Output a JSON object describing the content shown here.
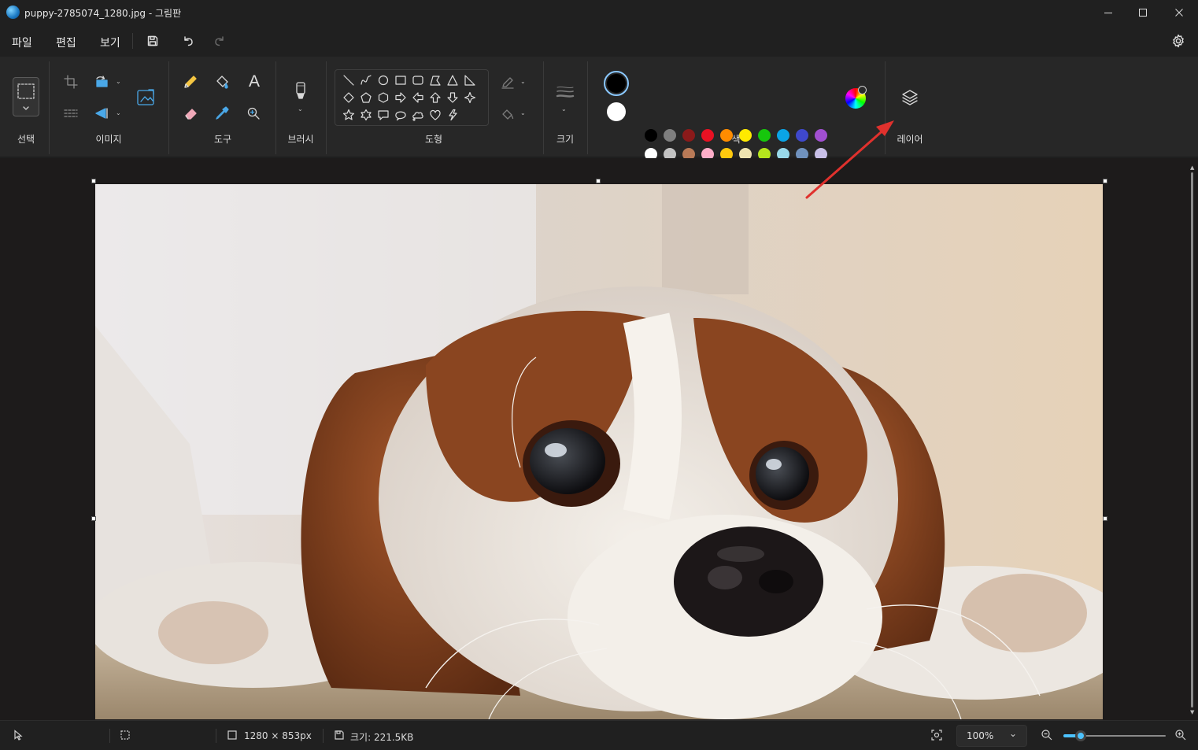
{
  "window": {
    "title": "puppy-2785074_1280.jpg - 그림판"
  },
  "menu": {
    "file": "파일",
    "edit": "편집",
    "view": "보기"
  },
  "ribbon": {
    "groups": {
      "select": "선택",
      "image": "이미지",
      "tools": "도구",
      "brush": "브러시",
      "shapes": "도형",
      "size": "크기",
      "colors": "색",
      "layers": "레이어"
    },
    "text_tool_glyph": "A",
    "primary_color": "#000000",
    "secondary_color": "#ffffff",
    "palette_row1": [
      "#000000",
      "#7f7f7f",
      "#8b1a1a",
      "#e81123",
      "#ff8c00",
      "#ffea00",
      "#16c60c",
      "#0aa4e6",
      "#3f48cc",
      "#a14fd1"
    ],
    "palette_row2": [
      "#ffffff",
      "#c3c3c3",
      "#b97a57",
      "#ffaec9",
      "#ffc90e",
      "#efe4b0",
      "#b5e61d",
      "#99d9ea",
      "#7092be",
      "#c8bfe7"
    ]
  },
  "annotation": {
    "arrow_color": "#e0312d"
  },
  "status": {
    "canvas_size": "1280 × 853px",
    "file_size": "크기: 221.5KB",
    "zoom_value": "100%",
    "zoom_level": 0.17
  }
}
